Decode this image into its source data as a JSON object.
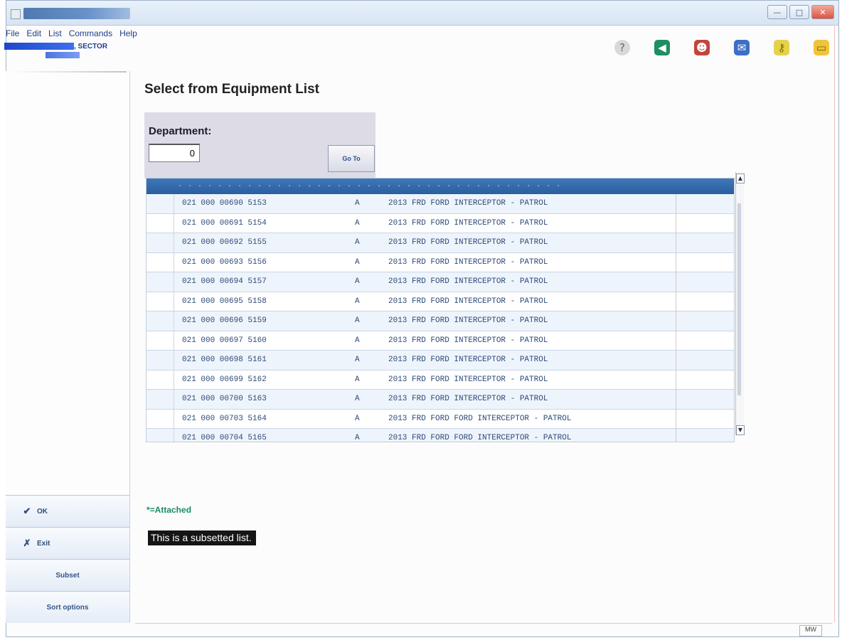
{
  "window": {
    "controls": {
      "minimize": "—",
      "maximize": "□",
      "close": "✕"
    }
  },
  "menu": [
    "File",
    "Edit",
    "List",
    "Commands",
    "Help"
  ],
  "org": {
    "sector_label": ", SECTOR"
  },
  "toolbar_icons": [
    "help-icon",
    "back-icon",
    "user-icon",
    "mail-icon",
    "key-icon",
    "folder-icon"
  ],
  "page": {
    "title": "Select from Equipment List",
    "department_label": "Department:",
    "department_value": "0",
    "goto_label": "Go To"
  },
  "rows": [
    {
      "id": "021 000 00690 5153",
      "status": "A",
      "desc": "2013 FRD FORD INTERCEPTOR - PATROL"
    },
    {
      "id": "021 000 00691 5154",
      "status": "A",
      "desc": "2013 FRD FORD INTERCEPTOR - PATROL"
    },
    {
      "id": "021 000 00692 5155",
      "status": "A",
      "desc": "2013 FRD FORD INTERCEPTOR - PATROL"
    },
    {
      "id": "021 000 00693 5156",
      "status": "A",
      "desc": "2013 FRD FORD INTERCEPTOR - PATROL"
    },
    {
      "id": "021 000 00694 5157",
      "status": "A",
      "desc": "2013 FRD FORD INTERCEPTOR - PATROL"
    },
    {
      "id": "021 000 00695 5158",
      "status": "A",
      "desc": "2013 FRD FORD INTERCEPTOR - PATROL"
    },
    {
      "id": "021 000 00696 5159",
      "status": "A",
      "desc": "2013 FRD FORD INTERCEPTOR - PATROL"
    },
    {
      "id": "021 000 00697 5160",
      "status": "A",
      "desc": "2013 FRD FORD INTERCEPTOR - PATROL"
    },
    {
      "id": "021 000 00698 5161",
      "status": "A",
      "desc": "2013 FRD FORD INTERCEPTOR - PATROL"
    },
    {
      "id": "021 000 00699 5162",
      "status": "A",
      "desc": "2013 FRD FORD INTERCEPTOR - PATROL"
    },
    {
      "id": "021 000 00700 5163",
      "status": "A",
      "desc": "2013 FRD FORD INTERCEPTOR - PATROL"
    },
    {
      "id": "021 000 00703 5164",
      "status": "A",
      "desc": "2013 FRD FORD FORD INTERCEPTOR - PATROL"
    },
    {
      "id": "021 000 00704 5165",
      "status": "A",
      "desc": "2013 FRD FORD FORD INTERCEPTOR - PATROL"
    }
  ],
  "attached_label": "*=Attached",
  "subset_note": "This is a subsetted list.",
  "sidebar": {
    "ok_label": "OK",
    "exit_label": "Exit",
    "subset_label": "Subset",
    "sort_label": "Sort options"
  },
  "status": {
    "mode": "MW"
  },
  "colors": {
    "header_blue": "#2a5f9f",
    "accent_green": "#1a8a6a",
    "panel_lavender": "#dcdbe6"
  }
}
